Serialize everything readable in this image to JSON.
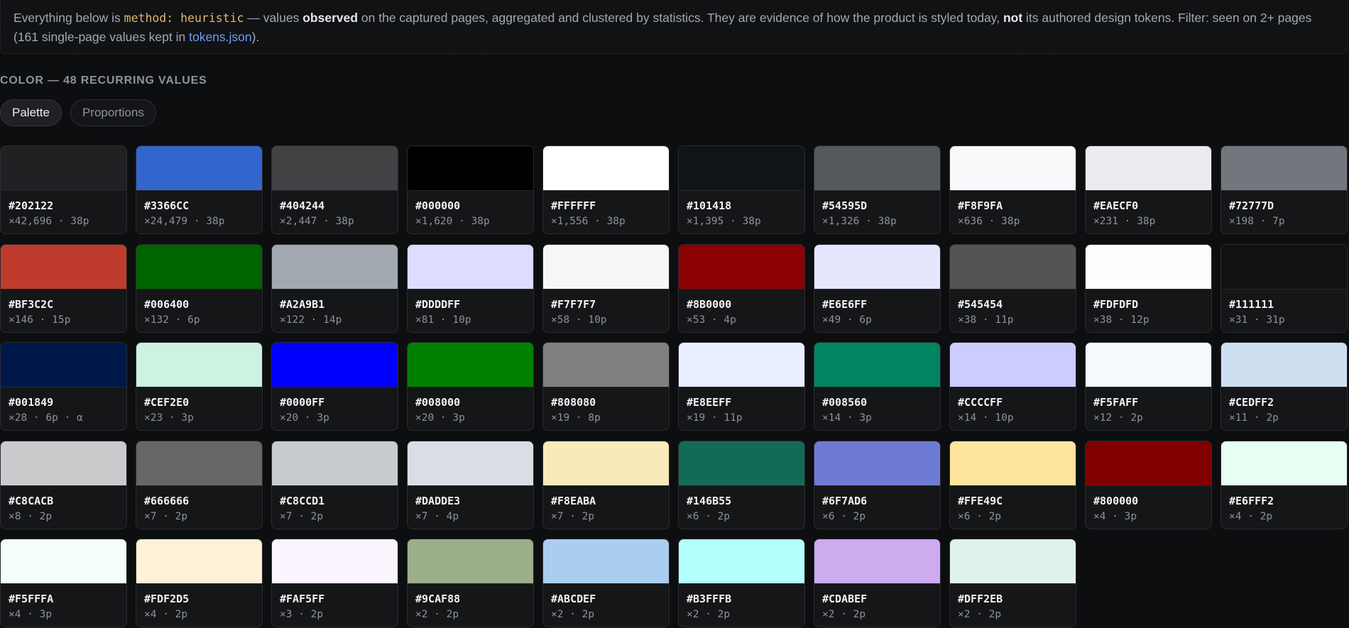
{
  "note": {
    "p1": "Everything below is ",
    "code": "method: heuristic",
    "p2": " — values ",
    "b1": "observed",
    "p3": " on the captured pages, aggregated and clustered by statistics. They are evidence of how the product is styled today, ",
    "b2": "not",
    "p4": " its authored design tokens. Filter: seen on 2+ pages (161 single-page values kept in ",
    "link": "tokens.json",
    "p5": ")."
  },
  "section": {
    "title": "COLOR — 48 RECURRING VALUES"
  },
  "tabs": [
    {
      "label": "Palette",
      "active": true
    },
    {
      "label": "Proportions",
      "active": false
    }
  ],
  "swatches": [
    {
      "hex": "#202122",
      "meta": "×42,696 · 38p"
    },
    {
      "hex": "#3366CC",
      "meta": "×24,479 · 38p"
    },
    {
      "hex": "#404244",
      "meta": "×2,447 · 38p"
    },
    {
      "hex": "#000000",
      "meta": "×1,620 · 38p"
    },
    {
      "hex": "#FFFFFF",
      "meta": "×1,556 · 38p"
    },
    {
      "hex": "#101418",
      "meta": "×1,395 · 38p"
    },
    {
      "hex": "#54595D",
      "meta": "×1,326 · 38p"
    },
    {
      "hex": "#F8F9FA",
      "meta": "×636 · 38p"
    },
    {
      "hex": "#EAECF0",
      "meta": "×231 · 38p"
    },
    {
      "hex": "#72777D",
      "meta": "×198 · 7p"
    },
    {
      "hex": "#BF3C2C",
      "meta": "×146 · 15p"
    },
    {
      "hex": "#006400",
      "meta": "×132 · 6p"
    },
    {
      "hex": "#A2A9B1",
      "meta": "×122 · 14p"
    },
    {
      "hex": "#DDDDFF",
      "meta": "×81 · 10p"
    },
    {
      "hex": "#F7F7F7",
      "meta": "×58 · 10p"
    },
    {
      "hex": "#8B0000",
      "meta": "×53 · 4p"
    },
    {
      "hex": "#E6E6FF",
      "meta": "×49 · 6p"
    },
    {
      "hex": "#545454",
      "meta": "×38 · 11p"
    },
    {
      "hex": "#FDFDFD",
      "meta": "×38 · 12p"
    },
    {
      "hex": "#111111",
      "meta": "×31 · 31p"
    },
    {
      "hex": "#001849",
      "meta": "×28 · 6p · α"
    },
    {
      "hex": "#CEF2E0",
      "meta": "×23 · 3p"
    },
    {
      "hex": "#0000FF",
      "meta": "×20 · 3p"
    },
    {
      "hex": "#008000",
      "meta": "×20 · 3p"
    },
    {
      "hex": "#808080",
      "meta": "×19 · 8p"
    },
    {
      "hex": "#E8EEFF",
      "meta": "×19 · 11p"
    },
    {
      "hex": "#008560",
      "meta": "×14 · 3p"
    },
    {
      "hex": "#CCCCFF",
      "meta": "×14 · 10p"
    },
    {
      "hex": "#F5FAFF",
      "meta": "×12 · 2p"
    },
    {
      "hex": "#CEDFF2",
      "meta": "×11 · 2p"
    },
    {
      "hex": "#C8CACB",
      "meta": "×8 · 2p"
    },
    {
      "hex": "#666666",
      "meta": "×7 · 2p"
    },
    {
      "hex": "#C8CCD1",
      "meta": "×7 · 2p"
    },
    {
      "hex": "#DADDE3",
      "meta": "×7 · 4p"
    },
    {
      "hex": "#F8EABA",
      "meta": "×7 · 2p"
    },
    {
      "hex": "#146B55",
      "meta": "×6 · 2p"
    },
    {
      "hex": "#6F7AD6",
      "meta": "×6 · 2p"
    },
    {
      "hex": "#FFE49C",
      "meta": "×6 · 2p"
    },
    {
      "hex": "#800000",
      "meta": "×4 · 3p"
    },
    {
      "hex": "#E6FFF2",
      "meta": "×4 · 2p"
    },
    {
      "hex": "#F5FFFA",
      "meta": "×4 · 3p"
    },
    {
      "hex": "#FDF2D5",
      "meta": "×4 · 2p"
    },
    {
      "hex": "#FAF5FF",
      "meta": "×3 · 2p"
    },
    {
      "hex": "#9CAF88",
      "meta": "×2 · 2p"
    },
    {
      "hex": "#ABCDEF",
      "meta": "×2 · 2p"
    },
    {
      "hex": "#B3FFFB",
      "meta": "×2 · 2p"
    },
    {
      "hex": "#CDABEF",
      "meta": "×2 · 2p"
    },
    {
      "hex": "#DFF2EB",
      "meta": "×2 · 2p"
    }
  ]
}
